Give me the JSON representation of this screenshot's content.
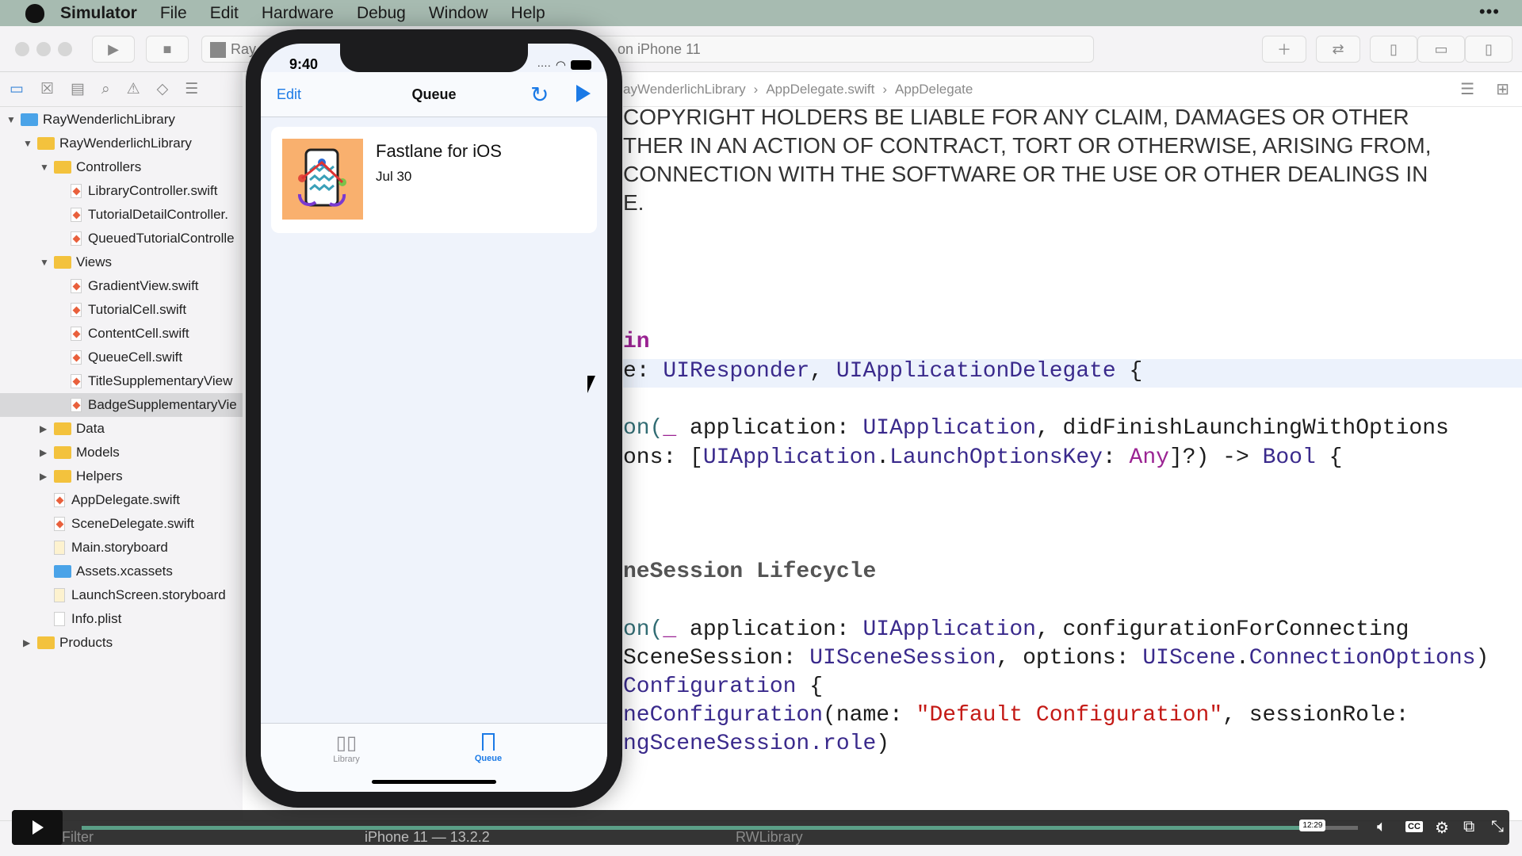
{
  "menubar": {
    "app": "Simulator",
    "items": [
      "File",
      "Edit",
      "Hardware",
      "Debug",
      "Window",
      "Help"
    ],
    "more": "•••"
  },
  "toolbar": {
    "scheme_left": "Ray",
    "scheme_right": "on iPhone 11"
  },
  "breadcrumb": [
    "ayWenderlichLibrary",
    "AppDelegate.swift",
    "AppDelegate"
  ],
  "navigator": {
    "rows": [
      {
        "label": "RayWenderlichLibrary",
        "level": 0,
        "type": "project",
        "open": true
      },
      {
        "label": "RayWenderlichLibrary",
        "level": 1,
        "type": "folder",
        "open": true
      },
      {
        "label": "Controllers",
        "level": 2,
        "type": "folder",
        "open": true
      },
      {
        "label": "LibraryController.swift",
        "level": 3,
        "type": "swift"
      },
      {
        "label": "TutorialDetailController.",
        "level": 3,
        "type": "swift"
      },
      {
        "label": "QueuedTutorialControlle",
        "level": 3,
        "type": "swift"
      },
      {
        "label": "Views",
        "level": 2,
        "type": "folder",
        "open": true
      },
      {
        "label": "GradientView.swift",
        "level": 3,
        "type": "swift"
      },
      {
        "label": "TutorialCell.swift",
        "level": 3,
        "type": "swift"
      },
      {
        "label": "ContentCell.swift",
        "level": 3,
        "type": "swift"
      },
      {
        "label": "QueueCell.swift",
        "level": 3,
        "type": "swift"
      },
      {
        "label": "TitleSupplementaryView",
        "level": 3,
        "type": "swift"
      },
      {
        "label": "BadgeSupplementaryVie",
        "level": 3,
        "type": "swift",
        "selected": true
      },
      {
        "label": "Data",
        "level": 2,
        "type": "folder",
        "open": false
      },
      {
        "label": "Models",
        "level": 2,
        "type": "folder",
        "open": false
      },
      {
        "label": "Helpers",
        "level": 2,
        "type": "folder",
        "open": false
      },
      {
        "label": "AppDelegate.swift",
        "level": 2,
        "type": "swift"
      },
      {
        "label": "SceneDelegate.swift",
        "level": 2,
        "type": "swift"
      },
      {
        "label": "Main.storyboard",
        "level": 2,
        "type": "storyboard"
      },
      {
        "label": "Assets.xcassets",
        "level": 2,
        "type": "assets"
      },
      {
        "label": "LaunchScreen.storyboard",
        "level": 2,
        "type": "storyboard"
      },
      {
        "label": "Info.plist",
        "level": 2,
        "type": "plist"
      },
      {
        "label": "Products",
        "level": 1,
        "type": "folder",
        "open": false
      }
    ]
  },
  "code": {
    "c1": "COPYRIGHT HOLDERS BE LIABLE FOR ANY CLAIM, DAMAGES OR OTHER",
    "c2": "THER IN AN ACTION OF CONTRACT, TORT OR OTHERWISE, ARISING FROM,",
    "c3": "CONNECTION WITH THE SOFTWARE OR THE USE OR OTHER DEALINGS IN",
    "c4": "E.",
    "l1": "in",
    "l2a": "e: ",
    "l2b": "UIResponder",
    "l2c": ", ",
    "l2d": "UIApplicationDelegate",
    "l2e": " {",
    "l3a": "on(",
    "l3b": "_",
    "l3c": " application: ",
    "l3d": "UIApplication",
    "l3e": ", didFinishLaunchingWithOptions",
    "l4a": "ons: [",
    "l4b": "UIApplication",
    "l4c": ".",
    "l4d": "LaunchOptionsKey",
    "l4e": ": ",
    "l4f": "Any",
    "l4g": "]?) -> ",
    "l4h": "Bool",
    "l4i": " {",
    "l5": "neSession Lifecycle",
    "l6a": "on(",
    "l6b": "_",
    "l6c": " application: ",
    "l6d": "UIApplication",
    "l6e": ", configurationForConnecting",
    "l7a": "SceneSession: ",
    "l7b": "UISceneSession",
    "l7c": ", options: ",
    "l7d": "UIScene",
    "l7e": ".",
    "l7f": "ConnectionOptions",
    "l7g": ")",
    "l8a": "Configuration",
    "l8b": " {",
    "l9a": "neConfiguration",
    "l9b": "(name: ",
    "l9c": "\"Default Configuration\"",
    "l9d": ", sessionRole:",
    "l10a": "ngSceneSession.",
    "l10b": "role",
    "l10c": ")"
  },
  "phone": {
    "time": "9:40",
    "nav": {
      "edit": "Edit",
      "title": "Queue"
    },
    "card": {
      "title": "Fastlane for iOS",
      "date": "Jul 30"
    },
    "tabs": [
      {
        "label": "Library",
        "active": false
      },
      {
        "label": "Queue",
        "active": true
      }
    ],
    "accent": "#1b7ae6"
  },
  "xcode_bottom": {
    "filter": "Filter",
    "device": "iPhone 11 — 13.2.2",
    "target": "RWLibrary"
  },
  "video": {
    "time_tooltip": "12:29",
    "progress": 0.963,
    "cc": "CC",
    "accent": "#5a9e86"
  }
}
